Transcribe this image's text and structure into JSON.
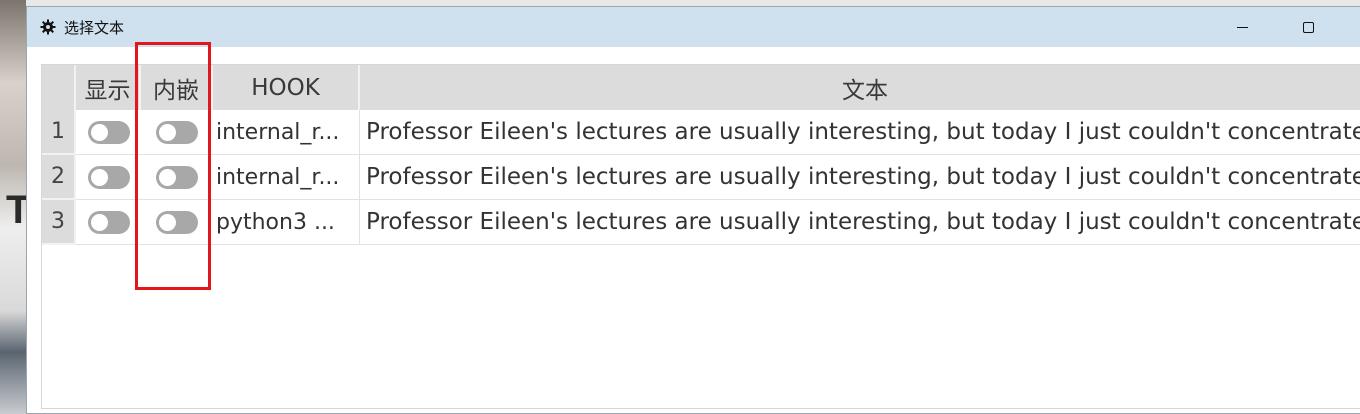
{
  "window": {
    "title": "选择文本",
    "icon": "gear-icon"
  },
  "table": {
    "headers": {
      "rownum": "",
      "show": "显示",
      "embed": "内嵌",
      "hook": "HOOK",
      "text": "文本"
    },
    "rows": [
      {
        "num": "1",
        "show": false,
        "embed": false,
        "hook": "internal_r...",
        "text": "Professor Eileen's lectures are usually interesting, but today I just couldn't concentrate o"
      },
      {
        "num": "2",
        "show": false,
        "embed": false,
        "hook": "internal_r...",
        "text": "Professor Eileen's lectures are usually interesting, but today I just couldn't concentrate o"
      },
      {
        "num": "3",
        "show": false,
        "embed": false,
        "hook": "python3 ...",
        "text": "Professor Eileen's lectures are usually interesting, but today I just couldn't concentrate o"
      }
    ]
  },
  "annotation": {
    "color": "#e3161b"
  },
  "background": {
    "left_letter": "T"
  }
}
